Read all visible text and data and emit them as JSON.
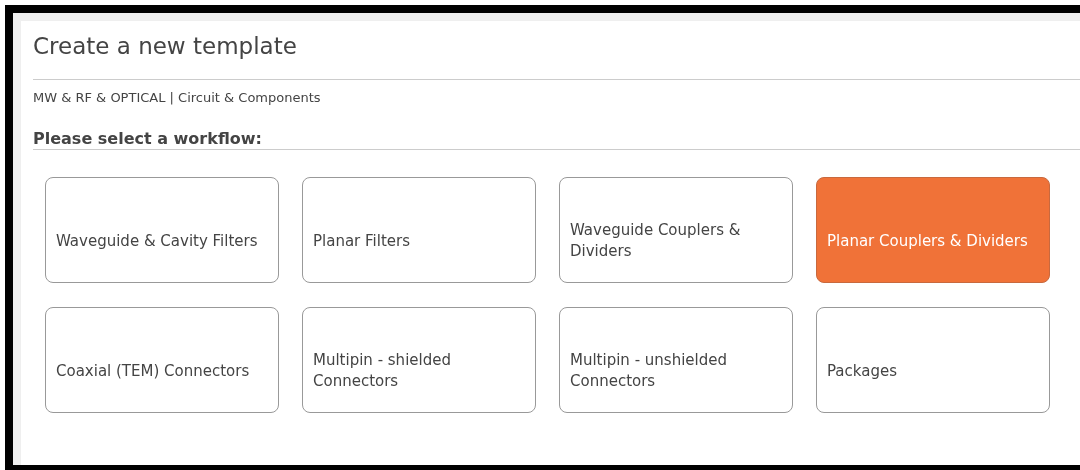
{
  "title": "Create a new template",
  "breadcrumb": "MW & RF & OPTICAL | Circuit & Components",
  "heading": "Please select a workflow:",
  "workflows": [
    {
      "label": "Waveguide & Cavity Filters",
      "selected": false
    },
    {
      "label": "Planar Filters",
      "selected": false
    },
    {
      "label": "Waveguide Couplers & Dividers",
      "selected": false
    },
    {
      "label": "Planar Couplers & Dividers",
      "selected": true
    },
    {
      "label": "Coaxial (TEM) Connectors",
      "selected": false
    },
    {
      "label": "Multipin - shielded Connectors",
      "selected": false
    },
    {
      "label": "Multipin - unshielded Connectors",
      "selected": false
    },
    {
      "label": "Packages",
      "selected": false
    }
  ]
}
